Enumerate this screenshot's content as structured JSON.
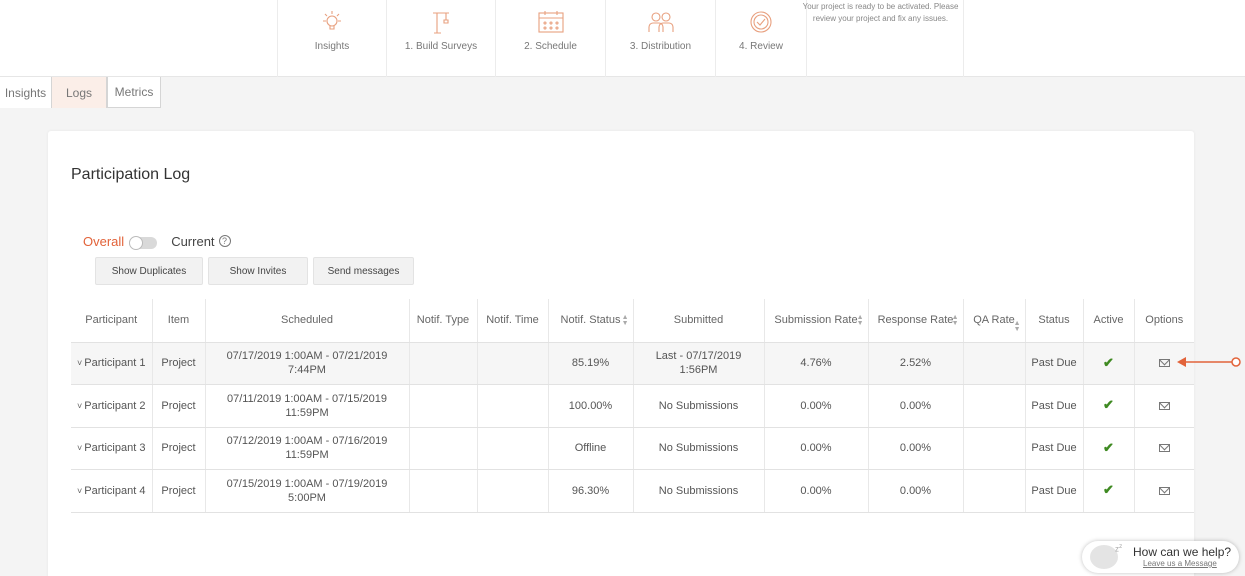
{
  "steps": [
    {
      "label": "Insights",
      "icon": "lightbulb-icon"
    },
    {
      "label": "1. Build Surveys",
      "icon": "crane-icon"
    },
    {
      "label": "2. Schedule",
      "icon": "calendar-icon"
    },
    {
      "label": "3. Distribution",
      "icon": "people-icon"
    },
    {
      "label": "4. Review",
      "icon": "check-circle-icon"
    }
  ],
  "notice": "Your project is ready to be activated. Please review your project and fix any issues.",
  "tabs": [
    "Insights",
    "Logs",
    "Metrics"
  ],
  "active_tab": "Logs",
  "page_title": "Participation Log",
  "toggle": {
    "overall": "Overall",
    "current": "Current",
    "help": "?"
  },
  "buttons": {
    "show_duplicates": "Show Duplicates",
    "show_invites": "Show Invites",
    "send_messages": "Send messages"
  },
  "columns": [
    "Participant",
    "Item",
    "Scheduled",
    "Notif. Type",
    "Notif. Time",
    "Notif. Status",
    "Submitted",
    "Submission Rate",
    "Response Rate",
    "QA Rate",
    "Status",
    "Active",
    "Options"
  ],
  "rows": [
    {
      "participant": "Participant 1",
      "item": "Project",
      "scheduled": "07/17/2019 1:00AM - 07/21/2019 7:44PM",
      "notif_type": "",
      "notif_time": "",
      "notif_status": "85.19%",
      "submitted": "Last - 07/17/2019 1:56PM",
      "submission_rate": "4.76%",
      "response_rate": "2.52%",
      "qa_rate": "",
      "status": "Past Due"
    },
    {
      "participant": "Participant 2",
      "item": "Project",
      "scheduled": "07/11/2019 1:00AM - 07/15/2019 11:59PM",
      "notif_type": "",
      "notif_time": "",
      "notif_status": "100.00%",
      "submitted": "No Submissions",
      "submission_rate": "0.00%",
      "response_rate": "0.00%",
      "qa_rate": "",
      "status": "Past Due"
    },
    {
      "participant": "Participant 3",
      "item": "Project",
      "scheduled": "07/12/2019 1:00AM - 07/16/2019 11:59PM",
      "notif_type": "",
      "notif_time": "",
      "notif_status": "Offline",
      "submitted": "No Submissions",
      "submission_rate": "0.00%",
      "response_rate": "0.00%",
      "qa_rate": "",
      "status": "Past Due"
    },
    {
      "participant": "Participant 4",
      "item": "Project",
      "scheduled": "07/15/2019 1:00AM - 07/19/2019 5:00PM",
      "notif_type": "",
      "notif_time": "",
      "notif_status": "96.30%",
      "submitted": "No Submissions",
      "submission_rate": "0.00%",
      "response_rate": "0.00%",
      "qa_rate": "",
      "status": "Past Due"
    }
  ],
  "chat": {
    "title": "How can we help?",
    "subtitle": "Leave us a Message"
  },
  "colors": {
    "accent": "#e2633a",
    "check": "#3f8a22"
  }
}
